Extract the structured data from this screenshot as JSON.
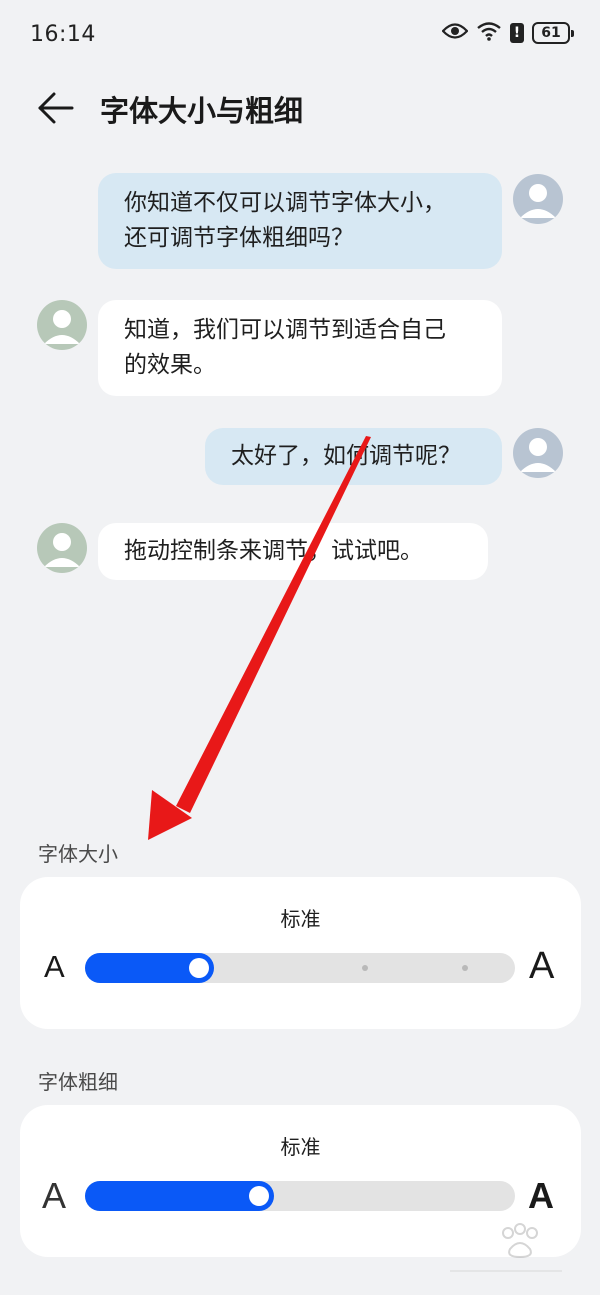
{
  "status_bar": {
    "time": "16:14",
    "battery": "61",
    "alert": "!"
  },
  "header": {
    "title": "字体大小与粗细"
  },
  "chat": {
    "messages": [
      {
        "side": "right",
        "line1": "你知道不仅可以调节字体大小，",
        "line2": "还可调节字体粗细吗？"
      },
      {
        "side": "left",
        "line1": "知道，我们可以调节到适合自己",
        "line2": "的效果。"
      },
      {
        "side": "right",
        "line1": "太好了，如何调节呢？"
      },
      {
        "side": "left",
        "line1": "拖动控制条来调节，试试吧。"
      }
    ]
  },
  "font_size": {
    "label": "字体大小",
    "value": "标准",
    "level_fraction": 0.3,
    "small_glyph": "A",
    "large_glyph": "A"
  },
  "font_weight": {
    "label": "字体粗细",
    "value": "标准",
    "level_fraction": 0.44,
    "small_glyph": "A",
    "large_glyph": "A"
  },
  "colors": {
    "accent": "#0a59f7",
    "annotation": "#e81818"
  }
}
